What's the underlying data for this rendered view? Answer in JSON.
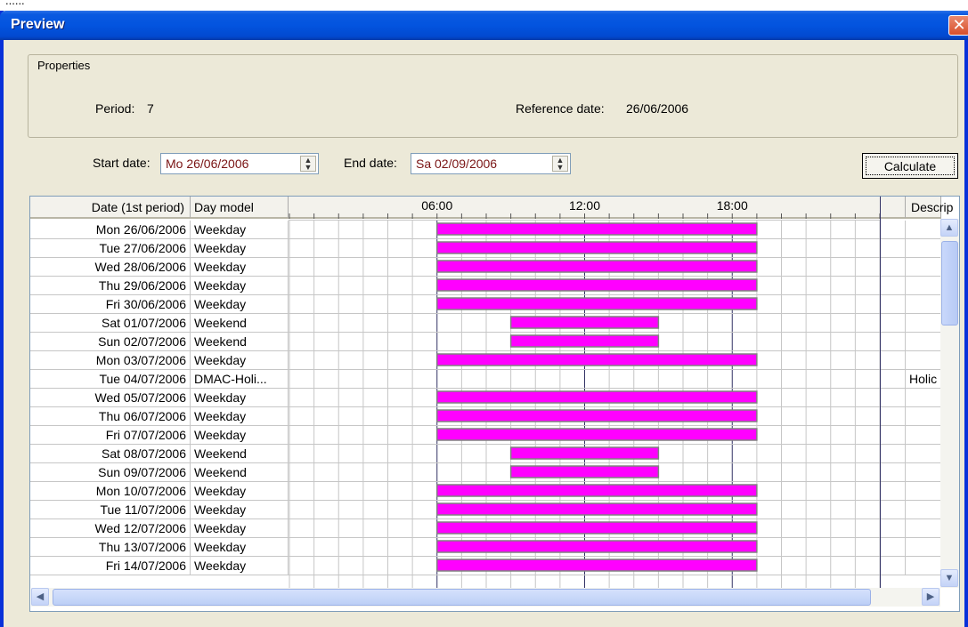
{
  "topbar_fragment": "...... ",
  "window": {
    "title": "Preview",
    "close_glyph": "✕"
  },
  "properties": {
    "legend": "Properties",
    "period_label": "Period:",
    "period_value": "7",
    "ref_label": "Reference date:",
    "ref_value": "26/06/2006"
  },
  "range": {
    "start_label": "Start date:",
    "start_value": "Mo 26/06/2006",
    "end_label": "End date:",
    "end_value": "Sa 02/09/2006",
    "calculate_label": "Calculate"
  },
  "grid": {
    "col_date": "Date (1st period)",
    "col_model": "Day model",
    "col_desc": "Descrip",
    "time_ticks": [
      "06:00",
      "12:00",
      "18:00"
    ],
    "rows": [
      {
        "date": "Mon 26/06/2006",
        "model": "Weekday",
        "desc": "",
        "start": 6,
        "end": 19
      },
      {
        "date": "Tue 27/06/2006",
        "model": "Weekday",
        "desc": "",
        "start": 6,
        "end": 19
      },
      {
        "date": "Wed 28/06/2006",
        "model": "Weekday",
        "desc": "",
        "start": 6,
        "end": 19
      },
      {
        "date": "Thu 29/06/2006",
        "model": "Weekday",
        "desc": "",
        "start": 6,
        "end": 19
      },
      {
        "date": "Fri 30/06/2006",
        "model": "Weekday",
        "desc": "",
        "start": 6,
        "end": 19
      },
      {
        "date": "Sat 01/07/2006",
        "model": "Weekend",
        "desc": "",
        "start": 9,
        "end": 15
      },
      {
        "date": "Sun 02/07/2006",
        "model": "Weekend",
        "desc": "",
        "start": 9,
        "end": 15
      },
      {
        "date": "Mon 03/07/2006",
        "model": "Weekday",
        "desc": "",
        "start": 6,
        "end": 19
      },
      {
        "date": "Tue 04/07/2006",
        "model": "DMAC-Holi...",
        "desc": "Holic",
        "start": null,
        "end": null
      },
      {
        "date": "Wed 05/07/2006",
        "model": "Weekday",
        "desc": "",
        "start": 6,
        "end": 19
      },
      {
        "date": "Thu 06/07/2006",
        "model": "Weekday",
        "desc": "",
        "start": 6,
        "end": 19
      },
      {
        "date": "Fri 07/07/2006",
        "model": "Weekday",
        "desc": "",
        "start": 6,
        "end": 19
      },
      {
        "date": "Sat 08/07/2006",
        "model": "Weekend",
        "desc": "",
        "start": 9,
        "end": 15
      },
      {
        "date": "Sun 09/07/2006",
        "model": "Weekend",
        "desc": "",
        "start": 9,
        "end": 15
      },
      {
        "date": "Mon 10/07/2006",
        "model": "Weekday",
        "desc": "",
        "start": 6,
        "end": 19
      },
      {
        "date": "Tue 11/07/2006",
        "model": "Weekday",
        "desc": "",
        "start": 6,
        "end": 19
      },
      {
        "date": "Wed 12/07/2006",
        "model": "Weekday",
        "desc": "",
        "start": 6,
        "end": 19
      },
      {
        "date": "Thu 13/07/2006",
        "model": "Weekday",
        "desc": "",
        "start": 6,
        "end": 19
      },
      {
        "date": "Fri 14/07/2006",
        "model": "Weekday",
        "desc": "",
        "start": 6,
        "end": 19
      }
    ]
  },
  "colors": {
    "bar": "#ff00ff",
    "titlebar": "#0354df",
    "dialog_bg": "#ece9d8"
  },
  "icons": {
    "close": "close-icon",
    "spin_up": "spin-up-icon",
    "spin_down": "spin-down-icon",
    "scroll_up": "scroll-up-icon",
    "scroll_down": "scroll-down-icon",
    "scroll_left": "scroll-left-icon",
    "scroll_right": "scroll-right-icon"
  }
}
